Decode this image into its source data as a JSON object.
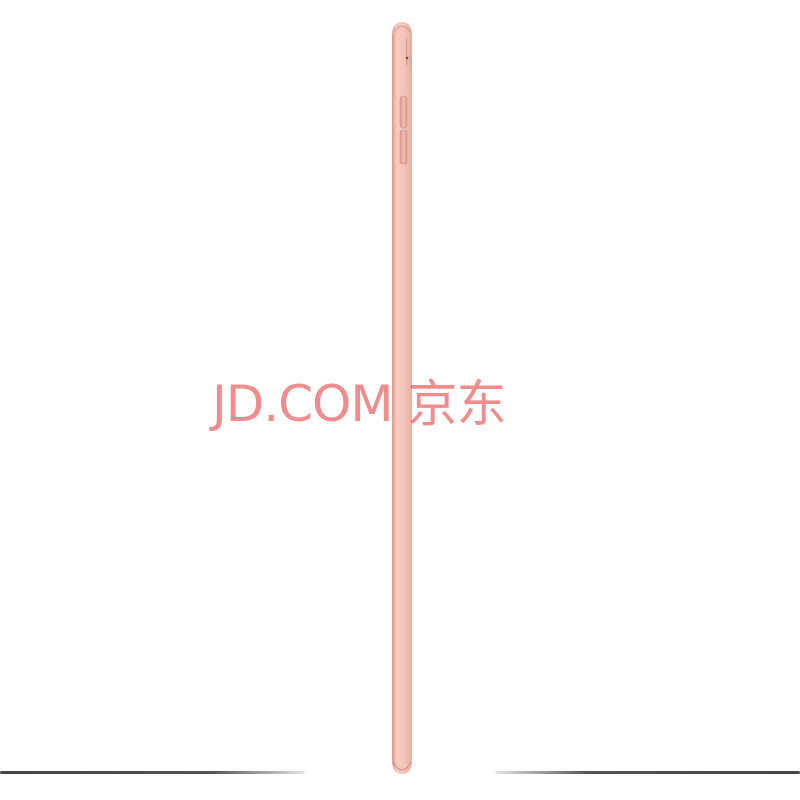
{
  "watermark": {
    "text": "JD.COM 京东",
    "color": "#e84646"
  },
  "product": {
    "color": "#f3c2b8",
    "edge_color": "#e3a89c",
    "background": "#ffffff"
  }
}
